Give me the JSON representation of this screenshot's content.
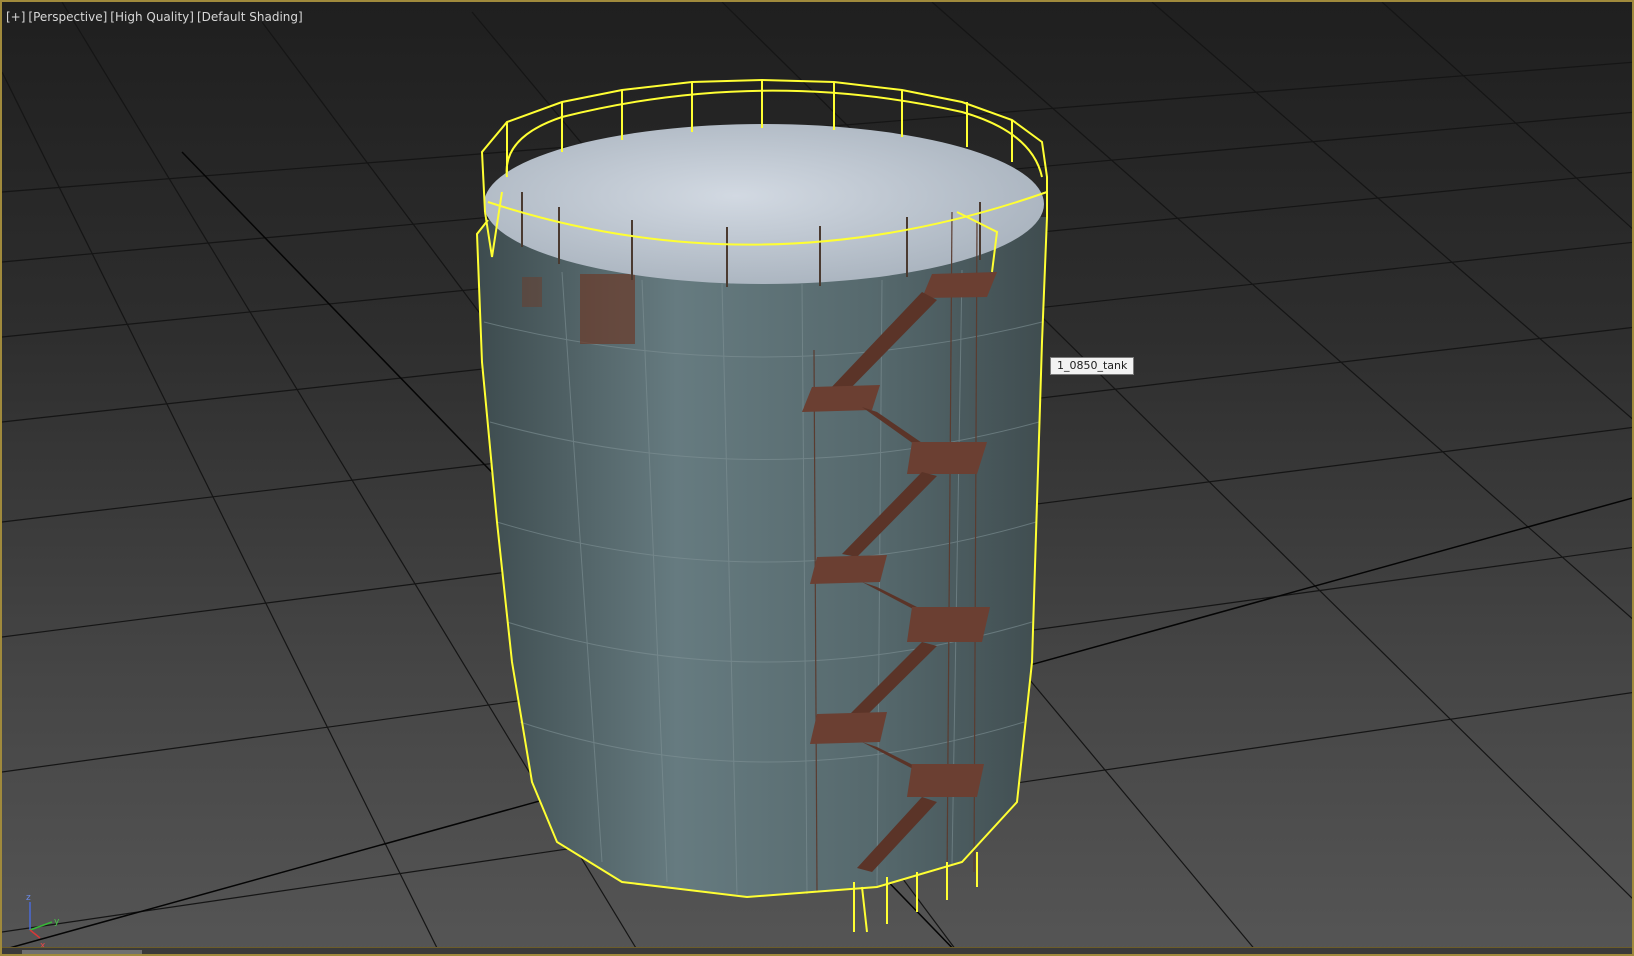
{
  "viewport": {
    "menu_label": "[+]",
    "view_label": "[Perspective]",
    "quality_label": "[High Quality]",
    "shading_label": "[Default Shading]"
  },
  "object": {
    "tooltip": "1_0850_tank"
  },
  "axis": {
    "z": "z",
    "x": "x",
    "y": "y"
  },
  "colors": {
    "selection": "#ffff33",
    "tank_wall": "#5f7478",
    "tank_top": "#c4ccd6",
    "rust": "#6b3b2a",
    "grid": "#111111"
  }
}
